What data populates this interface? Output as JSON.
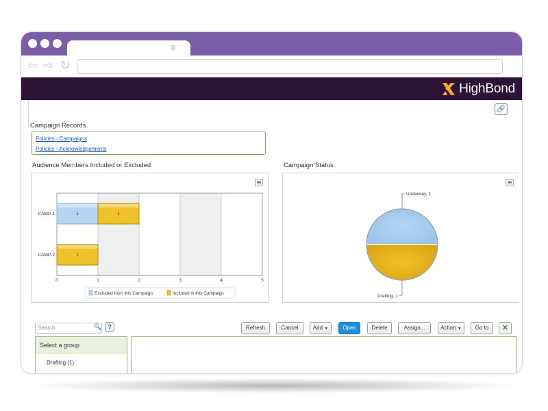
{
  "browser": {
    "tab_close": "⊗",
    "back": "⇦",
    "forward": "⇨",
    "refresh": "↻",
    "address": ""
  },
  "brand": {
    "name": "HighBond",
    "accent": "#f5a623",
    "bar_color": "#2c1237",
    "frame_color": "#7b5ea7"
  },
  "records": {
    "title": "Campaign Records",
    "links": [
      "Policies - Campaigns",
      "Policies - Acknowledgements"
    ]
  },
  "audience": {
    "title": "Audience Members Included or Excluded",
    "legend": [
      "Excluded from this Campaign",
      "Included in this Campaign"
    ]
  },
  "status": {
    "title": "Campaign Status"
  },
  "chart_data": [
    {
      "type": "bar",
      "orientation": "horizontal",
      "stacked": true,
      "categories": [
        "CAMP-1",
        "CAMP-2"
      ],
      "series": [
        {
          "name": "Excluded from this Campaign",
          "values": [
            1,
            0
          ],
          "color": "#b5d6f3"
        },
        {
          "name": "Included in this Campaign",
          "values": [
            1,
            1
          ],
          "color": "#f0c12a"
        }
      ],
      "x_ticks": [
        "0",
        "1",
        "2",
        "3",
        "4",
        "5"
      ],
      "xlim": [
        0,
        5
      ],
      "legend_position": "bottom",
      "grid": true
    },
    {
      "type": "pie",
      "slices": [
        {
          "label": "Underway, 1",
          "value": 1,
          "color": "#b5d6f3"
        },
        {
          "label": "Drafting, 1",
          "value": 1,
          "color": "#f0c12a"
        }
      ]
    }
  ],
  "toolbar": {
    "search_placeholder": "Search",
    "help": "?",
    "buttons": [
      "Refresh",
      "Cancel",
      "Add",
      "Open",
      "Delete",
      "Assign...",
      "Action",
      "Go to"
    ]
  },
  "groups": {
    "heading": "Select a group",
    "items": [
      "Drafting (1)"
    ]
  }
}
